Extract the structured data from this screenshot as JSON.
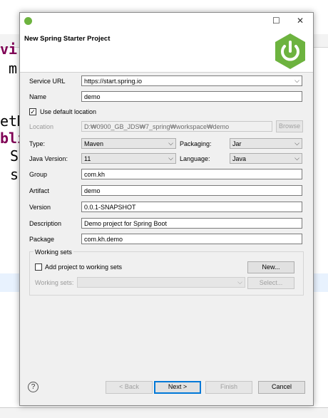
{
  "dialog": {
    "title": "New Spring Starter Project",
    "controls": {
      "maximize": "☐",
      "close": "✕"
    }
  },
  "fields": {
    "service_url": {
      "label": "Service URL",
      "value": "https://start.spring.io"
    },
    "name": {
      "label": "Name",
      "value": "demo"
    },
    "use_default_location": {
      "label": "Use default location",
      "checked": true
    },
    "location": {
      "label": "Location",
      "value": "D:₩0900_GB_JDS₩7_spring₩workspace₩demo",
      "browse": "Browse"
    },
    "type": {
      "label": "Type:",
      "value": "Maven"
    },
    "packaging": {
      "label": "Packaging:",
      "value": "Jar"
    },
    "java_version": {
      "label": "Java Version:",
      "value": "11"
    },
    "language": {
      "label": "Language:",
      "value": "Java"
    },
    "group": {
      "label": "Group",
      "value": "com.kh"
    },
    "artifact": {
      "label": "Artifact",
      "value": "demo"
    },
    "version": {
      "label": "Version",
      "value": "0.0.1-SNAPSHOT"
    },
    "description": {
      "label": "Description",
      "value": "Demo project for Spring Boot"
    },
    "package": {
      "label": "Package",
      "value": "com.kh.demo"
    }
  },
  "working_sets": {
    "group_label": "Working sets",
    "add_label": "Add project to working sets",
    "new_button": "New...",
    "sets_label": "Working sets:",
    "select_button": "Select..."
  },
  "buttons": {
    "back": "< Back",
    "next": "Next >",
    "finish": "Finish",
    "cancel": "Cancel",
    "help": "?"
  },
  "colors": {
    "spring_green": "#6db33f",
    "accent_blue": "#0078d7"
  }
}
